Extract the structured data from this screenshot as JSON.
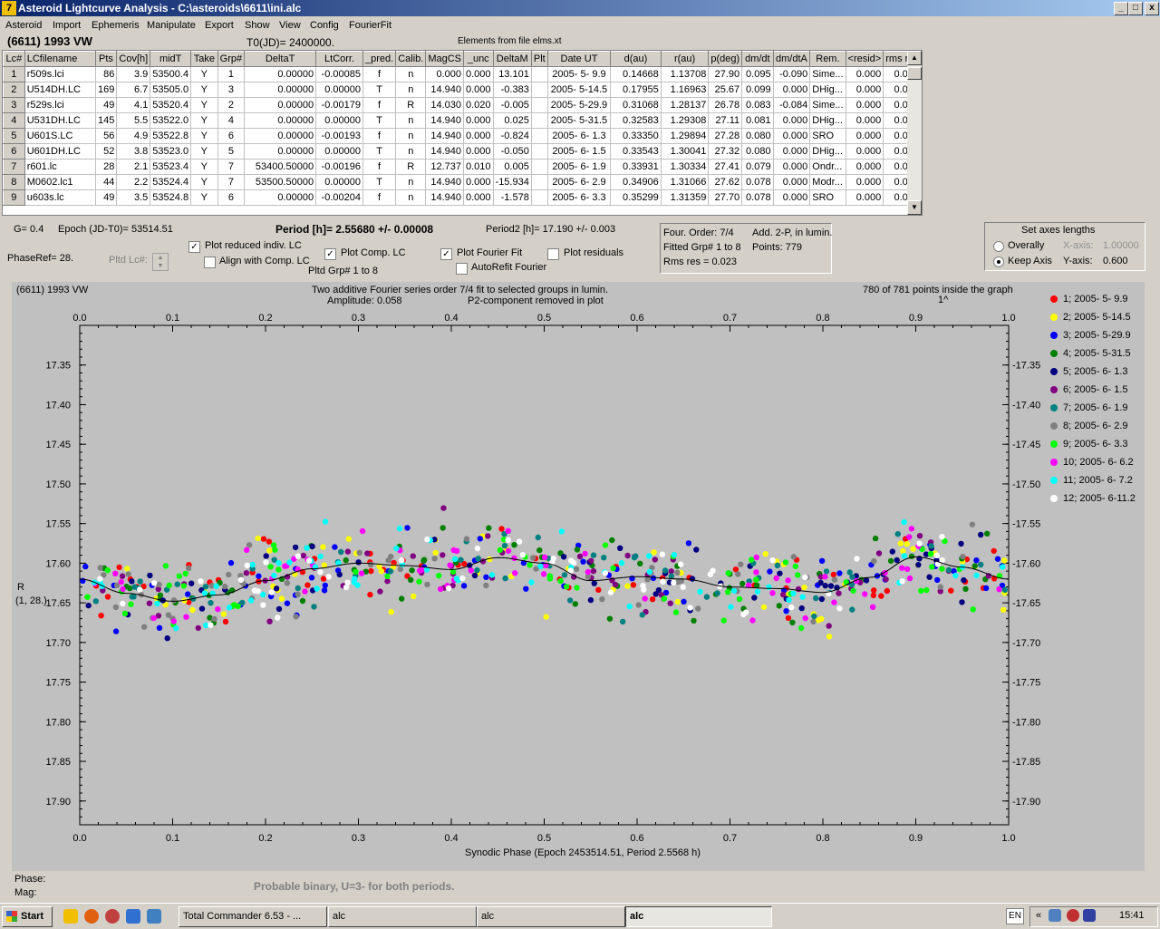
{
  "window": {
    "title": "Asteroid Lightcurve Analysis - C:\\asteroids\\6611\\ini.alc",
    "app_icon": "7",
    "controls": [
      "_",
      "□",
      "x"
    ]
  },
  "menu": [
    "Asteroid",
    "Import",
    "Ephemeris",
    "Manipulate",
    "Export",
    "Show",
    "View",
    "Config",
    "FourierFit"
  ],
  "header": {
    "object": "(6611) 1993 VW",
    "t0": "T0(JD)= 2400000.",
    "elements": "Elements from file elms.xt"
  },
  "table": {
    "columns": [
      "Lc#",
      "LCfilename",
      "Pts",
      "Cov[h]",
      "midT",
      "Take",
      "Grp#",
      "DeltaT",
      "LtCorr.",
      "_pred.",
      "Calib.",
      "MagCS",
      "_unc",
      "DeltaM",
      "Plt",
      "Date UT",
      "d(au)",
      "r(au)",
      "p(deg)",
      "dm/dt",
      "dm/dtA",
      "Rem.",
      "<resid>",
      "rms res"
    ],
    "rows": [
      [
        "1",
        "r509s.lci",
        "86",
        "3.9",
        "53500.4",
        "Y",
        "1",
        "0.00000",
        "-0.00085",
        "f",
        "n",
        "0.000",
        "0.000",
        "13.101",
        "",
        "2005- 5- 9.9",
        "0.14668",
        "1.13708",
        "27.90",
        "0.095",
        "-0.090",
        "Sime...",
        "0.000",
        "0.013"
      ],
      [
        "2",
        "U514DH.LC",
        "169",
        "6.7",
        "53505.0",
        "Y",
        "3",
        "0.00000",
        "0.00000",
        "T",
        "n",
        "14.940",
        "0.000",
        "-0.383",
        "",
        "2005- 5-14.5",
        "0.17955",
        "1.16963",
        "25.67",
        "0.099",
        "0.000",
        "DHig...",
        "0.000",
        "0.013"
      ],
      [
        "3",
        "r529s.lci",
        "49",
        "4.1",
        "53520.4",
        "Y",
        "2",
        "0.00000",
        "-0.00179",
        "f",
        "R",
        "14.030",
        "0.020",
        "-0.005",
        "",
        "2005- 5-29.9",
        "0.31068",
        "1.28137",
        "26.78",
        "0.083",
        "-0.084",
        "Sime...",
        "0.000",
        "0.023"
      ],
      [
        "4",
        "U531DH.LC",
        "145",
        "5.5",
        "53522.0",
        "Y",
        "4",
        "0.00000",
        "0.00000",
        "T",
        "n",
        "14.940",
        "0.000",
        "0.025",
        "",
        "2005- 5-31.5",
        "0.32583",
        "1.29308",
        "27.11",
        "0.081",
        "0.000",
        "DHig...",
        "0.000",
        "0.020"
      ],
      [
        "5",
        "U601S.LC",
        "56",
        "4.9",
        "53522.8",
        "Y",
        "6",
        "0.00000",
        "-0.00193",
        "f",
        "n",
        "14.940",
        "0.000",
        "-0.824",
        "",
        "2005- 6- 1.3",
        "0.33350",
        "1.29894",
        "27.28",
        "0.080",
        "0.000",
        "SRO",
        "0.000",
        "0.023"
      ],
      [
        "6",
        "U601DH.LC",
        "52",
        "3.8",
        "53523.0",
        "Y",
        "5",
        "0.00000",
        "0.00000",
        "T",
        "n",
        "14.940",
        "0.000",
        "-0.050",
        "",
        "2005- 6- 1.5",
        "0.33543",
        "1.30041",
        "27.32",
        "0.080",
        "0.000",
        "DHig...",
        "0.000",
        "0.025"
      ],
      [
        "7",
        "r601.lc",
        "28",
        "2.1",
        "53523.4",
        "Y",
        "7",
        "53400.50000",
        "-0.00196",
        "f",
        "R",
        "12.737",
        "0.010",
        "0.005",
        "",
        "2005- 6- 1.9",
        "0.33931",
        "1.30334",
        "27.41",
        "0.079",
        "0.000",
        "Ondr...",
        "0.000",
        "0.031"
      ],
      [
        "8",
        "M0602.lc1",
        "44",
        "2.2",
        "53524.4",
        "Y",
        "7",
        "53500.50000",
        "0.00000",
        "T",
        "n",
        "14.940",
        "0.000",
        "-15.934",
        "",
        "2005- 6- 2.9",
        "0.34906",
        "1.31066",
        "27.62",
        "0.078",
        "0.000",
        "Modr...",
        "0.000",
        "0.033"
      ],
      [
        "9",
        "u603s.lc",
        "49",
        "3.5",
        "53524.8",
        "Y",
        "6",
        "0.00000",
        "-0.00204",
        "f",
        "n",
        "14.940",
        "0.000",
        "-1.578",
        "",
        "2005- 6- 3.3",
        "0.35299",
        "1.31359",
        "27.70",
        "0.078",
        "0.000",
        "SRO",
        "0.000",
        "0.028"
      ]
    ]
  },
  "info": {
    "g": "G= 0.4",
    "epoch": "Epoch (JD-T0)= 53514.51",
    "period": "Period [h]= 2.55680 +/- 0.00008",
    "period2": "Period2 [h]= 17.190 +/- 0.003",
    "phaseref": "PhaseRef= 28.",
    "pltd_lc": "Pltd Lc#:",
    "pltd_grp": "Pltd Grp#  1  to  8"
  },
  "checkboxes": {
    "plot_reduced": {
      "label": "Plot reduced indiv. LC",
      "checked": true
    },
    "align_comp": {
      "label": "Align with Comp. LC",
      "checked": false
    },
    "plot_comp": {
      "label": "Plot Comp. LC",
      "checked": true
    },
    "plot_fourier": {
      "label": "Plot Fourier Fit",
      "checked": true
    },
    "plot_residuals": {
      "label": "Plot residuals",
      "checked": false
    },
    "autorefit": {
      "label": "AutoRefit Fourier",
      "checked": false
    }
  },
  "fourier_box": {
    "order": "Four. Order:  7/4",
    "add": "Add. 2-P, in lumin.",
    "fitted": "Fitted Grp# 1 to 8",
    "points": "Points: 779",
    "rms": "Rms res     = 0.023"
  },
  "axes_box": {
    "title": "Set axes lengths",
    "overally": "Overally",
    "keep_axis": "Keep Axis",
    "xaxis_label": "X-axis:",
    "xaxis_value": "1.00000",
    "yaxis_label": "Y-axis:",
    "yaxis_value": "0.600",
    "selected": "keep_axis"
  },
  "chart_data": {
    "type": "scatter",
    "object_label": "(6611) 1993 VW",
    "title_line1": "Two additive Fourier series order 7/4 fit to selected groups in lumin.",
    "title_line2": "Amplitude: 0.058",
    "title_line3": "P2-component removed in plot",
    "points_note": "780 of 781 points inside the graph",
    "points_note2": "1^",
    "xlabel": "Synodic Phase (Epoch 2453514.51, Period 2.5568 h)",
    "ylabel_line1": "R",
    "ylabel_line2": "(1, 28.)",
    "xlim": [
      0.0,
      1.0
    ],
    "ylim": [
      17.3,
      17.93
    ],
    "y_inverted": true,
    "xticks": [
      "0.0",
      "0.1",
      "0.2",
      "0.3",
      "0.4",
      "0.5",
      "0.6",
      "0.7",
      "0.8",
      "0.9",
      "1.0"
    ],
    "yticks": [
      "17.35",
      "17.40",
      "17.45",
      "17.50",
      "17.55",
      "17.60",
      "17.65",
      "17.70",
      "17.75",
      "17.80",
      "17.85",
      "17.90"
    ],
    "fit_curve": {
      "x": [
        0.0,
        0.05,
        0.1,
        0.15,
        0.2,
        0.25,
        0.3,
        0.35,
        0.4,
        0.45,
        0.5,
        0.55,
        0.6,
        0.65,
        0.7,
        0.75,
        0.8,
        0.85,
        0.9,
        0.95,
        1.0
      ],
      "y": [
        17.62,
        17.638,
        17.648,
        17.64,
        17.622,
        17.607,
        17.6,
        17.603,
        17.608,
        17.593,
        17.6,
        17.622,
        17.617,
        17.62,
        17.63,
        17.632,
        17.637,
        17.618,
        17.592,
        17.605,
        17.62
      ]
    },
    "series": [
      {
        "name": "1; 2005- 5- 9.9",
        "color": "#ff0000"
      },
      {
        "name": "2; 2005- 5-14.5",
        "color": "#ffff00"
      },
      {
        "name": "3; 2005- 5-29.9",
        "color": "#0000ff"
      },
      {
        "name": "4; 2005- 5-31.5",
        "color": "#008000"
      },
      {
        "name": "5; 2005- 6- 1.3",
        "color": "#000080"
      },
      {
        "name": "6; 2005- 6- 1.5",
        "color": "#800080"
      },
      {
        "name": "7; 2005- 6- 1.9",
        "color": "#008080"
      },
      {
        "name": "8; 2005- 6- 2.9",
        "color": "#808080"
      },
      {
        "name": "9; 2005- 6- 3.3",
        "color": "#00ff00"
      },
      {
        "name": "10; 2005- 6- 6.2",
        "color": "#ff00ff"
      },
      {
        "name": "11; 2005- 6- 7.2",
        "color": "#00ffff"
      },
      {
        "name": "12; 2005- 6-11.2",
        "color": "#ffffff"
      }
    ],
    "n_points_per_series": 60,
    "scatter_sigma": 0.022
  },
  "status": {
    "phase_label": "Phase:",
    "mag_label": "Mag:",
    "note": "Probable binary, U=3- for both periods."
  },
  "taskbar": {
    "start": "Start",
    "buttons": [
      "Total Commander 6.53 - ...",
      "alc",
      "alc",
      "alc"
    ],
    "lang": "EN",
    "clock": "15:41"
  }
}
